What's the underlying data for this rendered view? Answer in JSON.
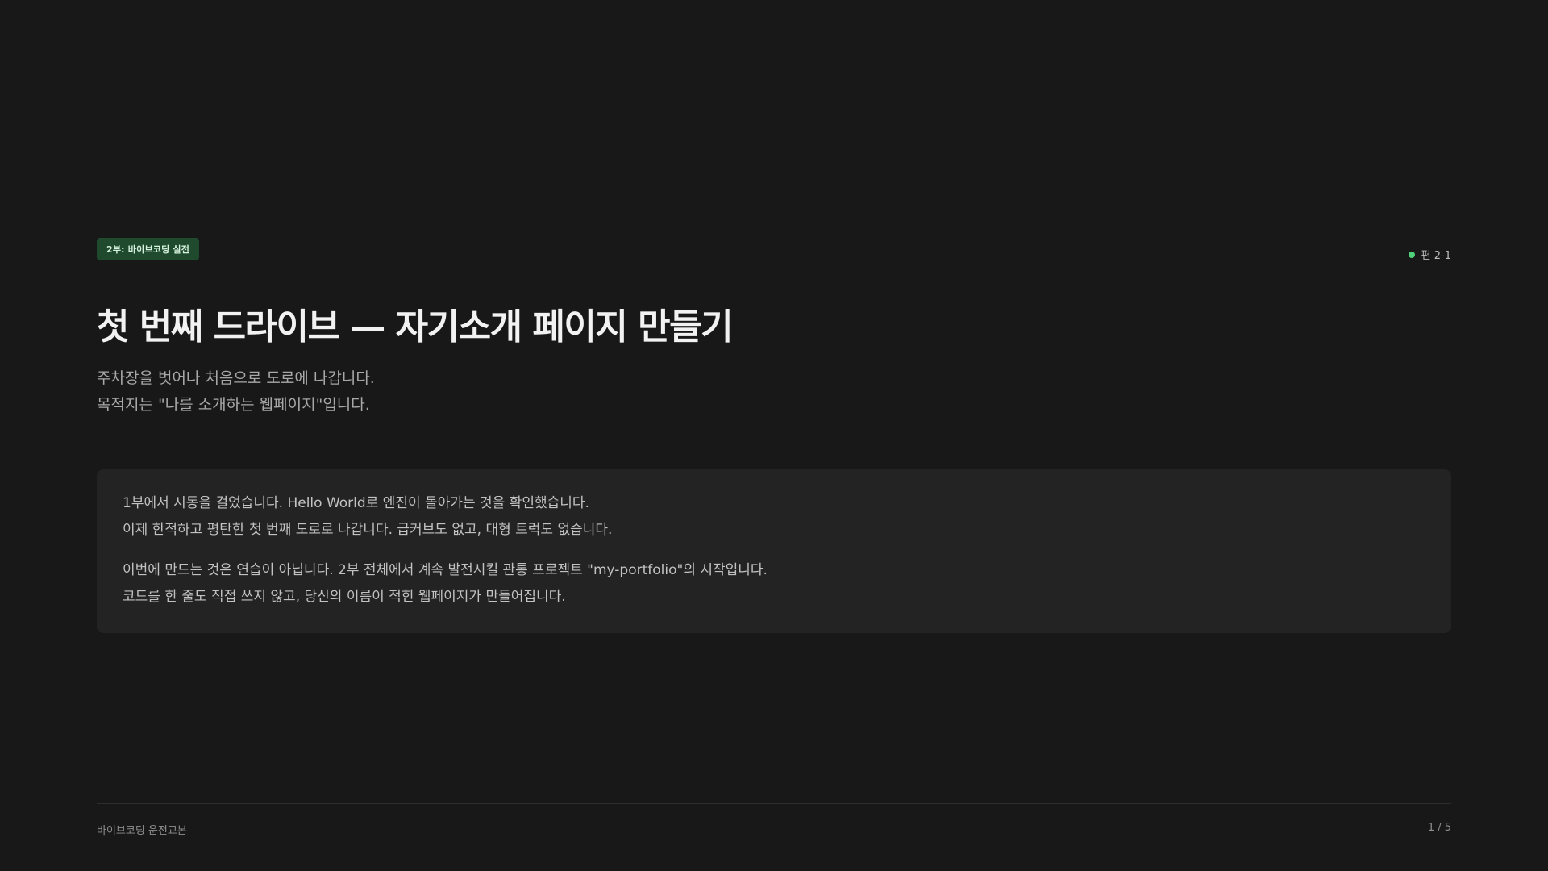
{
  "section_badge": "2부: 바이브코딩 실전",
  "episode_label": "편 2-1",
  "title": "첫 번째 드라이브 — 자기소개 페이지 만들기",
  "subtitle": {
    "line1": "주차장을 벗어나 처음으로 도로에 나갑니다.",
    "line2": "목적지는 \"나를 소개하는 웹페이지\"입니다."
  },
  "card": {
    "paragraph1": {
      "line1": "1부에서 시동을 걸었습니다. Hello World로 엔진이 돌아가는 것을 확인했습니다.",
      "line2": "이제 한적하고 평탄한 첫 번째 도로로 나갑니다. 급커브도 없고, 대형 트럭도 없습니다."
    },
    "paragraph2": {
      "line1": "이번에 만드는 것은 연습이 아닙니다. 2부 전체에서 계속 발전시킬 관통 프로젝트 \"my-portfolio\"의 시작입니다.",
      "line2": "코드를 한 줄도 직접 쓰지 않고, 당신의 이름이 적힌 웹페이지가 만들어집니다."
    }
  },
  "footer": {
    "book_title": "바이브코딩 운전교본",
    "page_indicator": "1 / 5"
  },
  "colors": {
    "background": "#181818",
    "badge_bg": "#1f4a2e",
    "accent_dot": "#4ed07a",
    "card_bg": "#232323"
  }
}
